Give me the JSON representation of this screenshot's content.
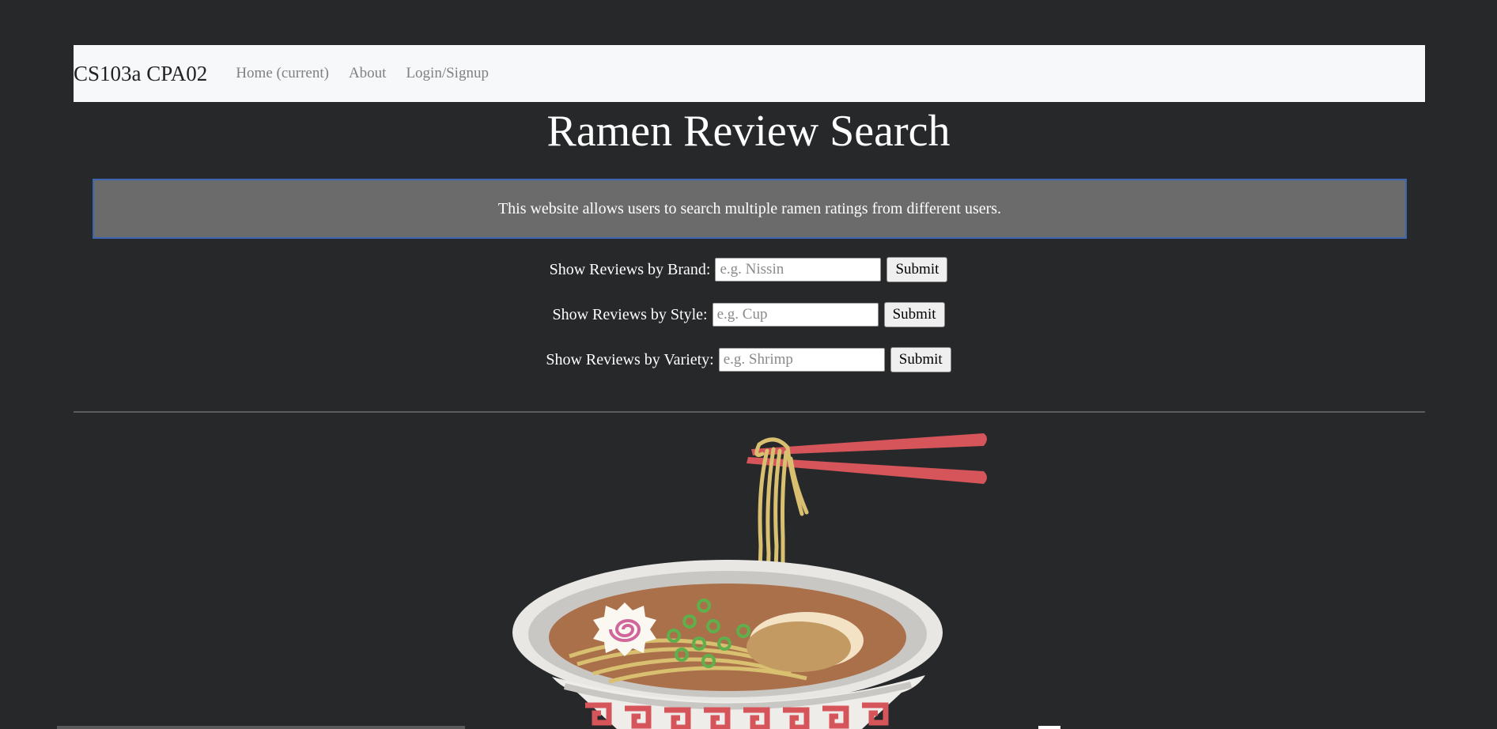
{
  "navbar": {
    "brand": "CS103a CPA02",
    "links": [
      "Home (current)",
      "About",
      "Login/Signup"
    ]
  },
  "main": {
    "title": "Ramen Review Search",
    "info": "This website allows users to search multiple ramen ratings from different users.",
    "forms": [
      {
        "label": "Show Reviews by Brand:",
        "placeholder": "e.g. Nissin",
        "button": "Submit"
      },
      {
        "label": "Show Reviews by Style:",
        "placeholder": "e.g. Cup",
        "button": "Submit"
      },
      {
        "label": "Show Reviews by Variety:",
        "placeholder": "e.g. Shrimp",
        "button": "Submit"
      }
    ]
  },
  "colors": {
    "background": "#27282a",
    "navbar": "#f7f8f9",
    "info_box": "#6b6b6b",
    "info_border": "#3d65b1",
    "chopsticks": "#d5555a"
  },
  "illustration": {
    "name": "ramen-bowl-illustration"
  }
}
